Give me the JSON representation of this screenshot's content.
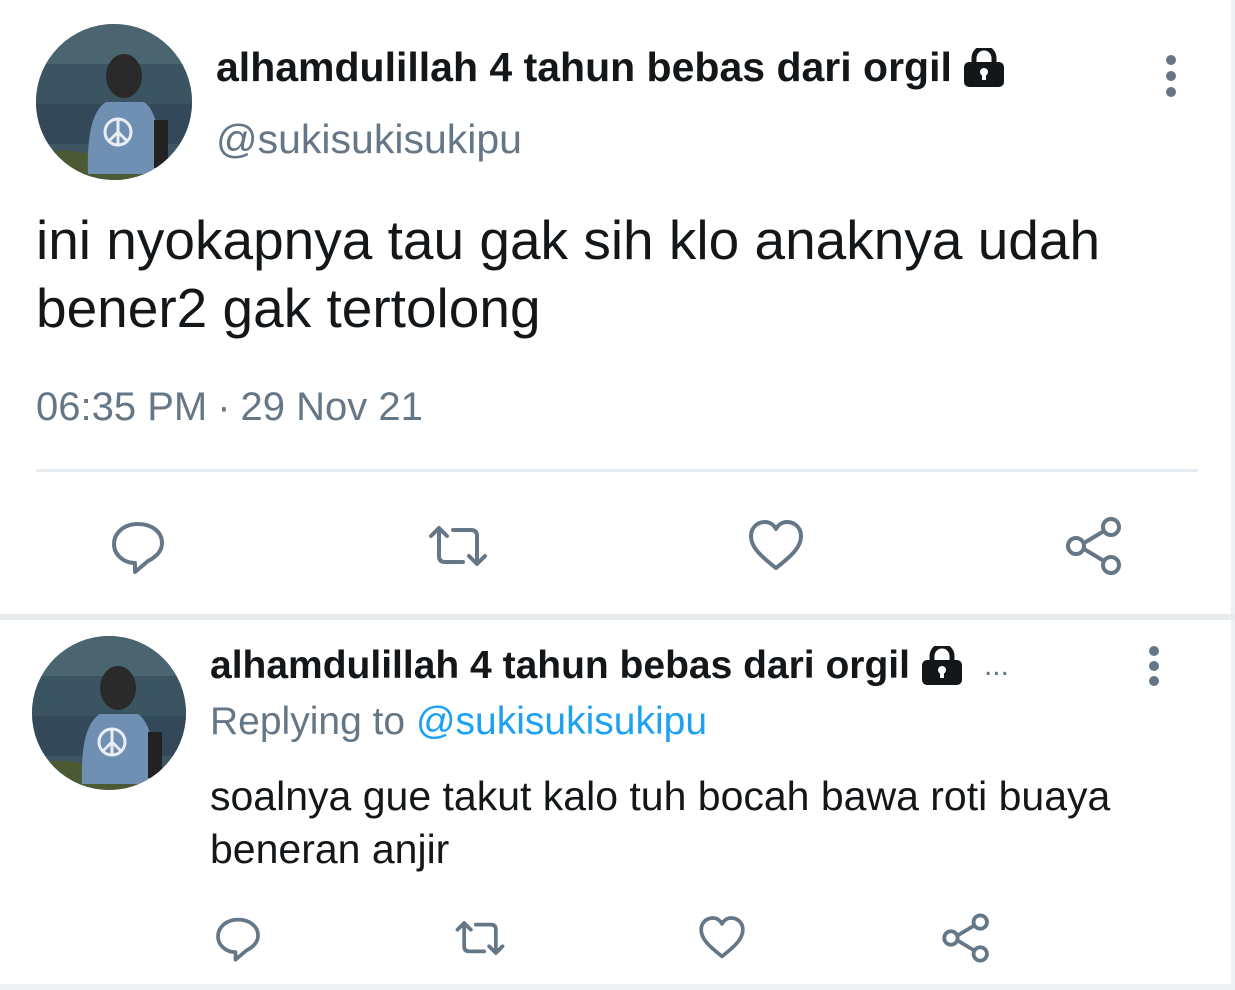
{
  "main_tweet": {
    "display_name": "alhamdulillah 4 tahun bebas dari orgil",
    "handle": "@sukisukisukipu",
    "text": "ini nyokapnya tau gak sih klo anaknya udah bener2 gak tertolong",
    "time": "06:35 PM",
    "separator": "·",
    "date": "29 Nov 21",
    "icons": {
      "protected": "lock-icon",
      "menu": "more-vertical-icon",
      "actions": [
        "reply-icon",
        "retweet-icon",
        "like-icon",
        "share-icon"
      ]
    }
  },
  "reply_tweet": {
    "display_name": "alhamdulillah 4 tahun bebas dari orgil",
    "truncation": "...",
    "replying_prefix": "Replying to",
    "replying_handle": "@sukisukisukipu",
    "text": "soalnya gue takut kalo tuh bocah bawa roti buaya beneran anjir",
    "icons": {
      "protected": "lock-icon",
      "menu": "more-vertical-icon",
      "actions": [
        "reply-icon",
        "retweet-icon",
        "like-icon",
        "share-icon"
      ]
    }
  },
  "colors": {
    "text_primary": "#14171a",
    "text_secondary": "#657786",
    "link": "#1da1f2",
    "divider": "#e6ecf0"
  }
}
